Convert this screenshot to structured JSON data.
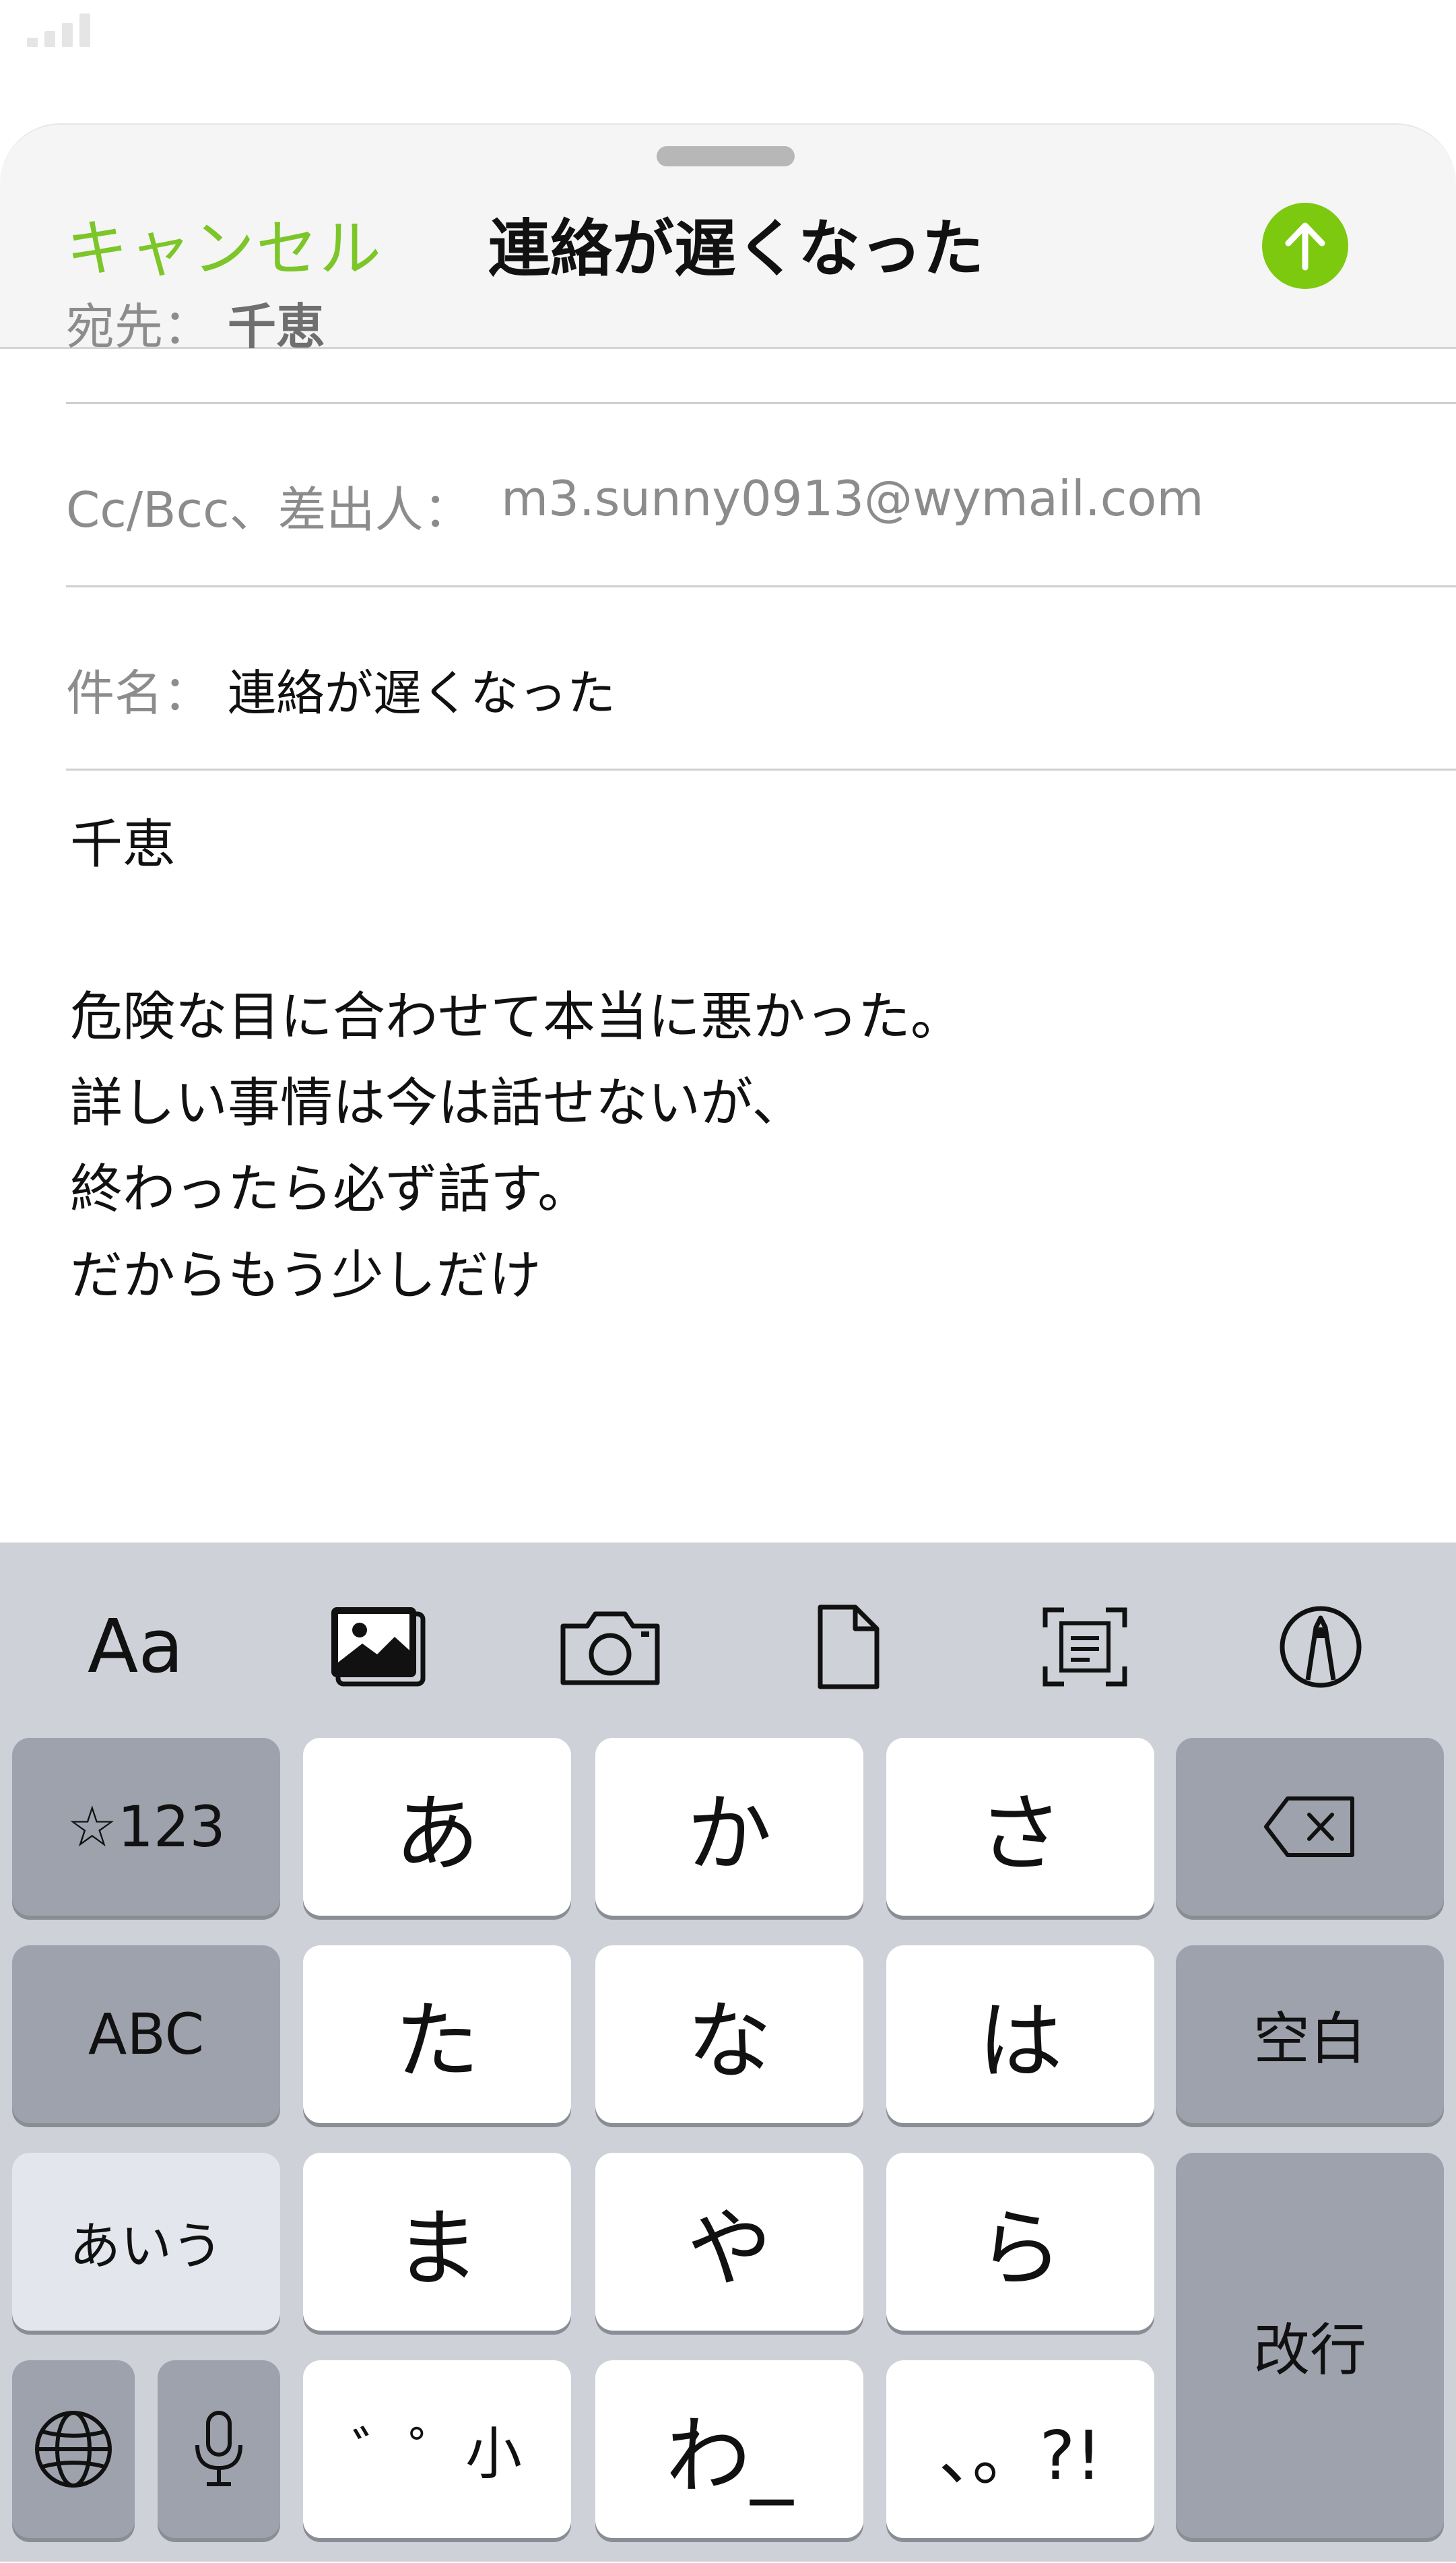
{
  "compose": {
    "cancel_label": "キャンセル",
    "title": "連絡が遅くなった",
    "send_icon": "arrow-up-icon",
    "accent_color": "#7cc90f"
  },
  "fields": {
    "to_label": "宛先：",
    "to_value": "千恵",
    "cc_label": "Cc/Bcc、差出人：",
    "cc_value": "m3.sunny0913@wymail.com",
    "subject_label": "件名：",
    "subject_value": "連絡が遅くなった"
  },
  "body": {
    "lines": [
      "千恵",
      "",
      "危険な目に合わせて本当に悪かった。",
      "詳しい事情は今は話せないが、",
      "終わったら必ず話す。",
      "だからもう少しだけ"
    ]
  },
  "keyboard": {
    "toolbar": {
      "format_label": "Aa",
      "photo_icon": "photo-library-icon",
      "camera_icon": "camera-icon",
      "file_icon": "document-icon",
      "scan_icon": "scan-document-icon",
      "markup_icon": "markup-pen-icon"
    },
    "keys": {
      "symbols": "☆123",
      "a": "あ",
      "ka": "か",
      "sa": "さ",
      "abc": "ABC",
      "ta": "た",
      "na": "な",
      "ha": "は",
      "space": "空白",
      "aiu": "あいう",
      "ma": "ま",
      "ya": "や",
      "ra": "ら",
      "return": "改行",
      "dakuten": "゛゜小",
      "wa": "わ_",
      "punct": "、。?!"
    }
  }
}
